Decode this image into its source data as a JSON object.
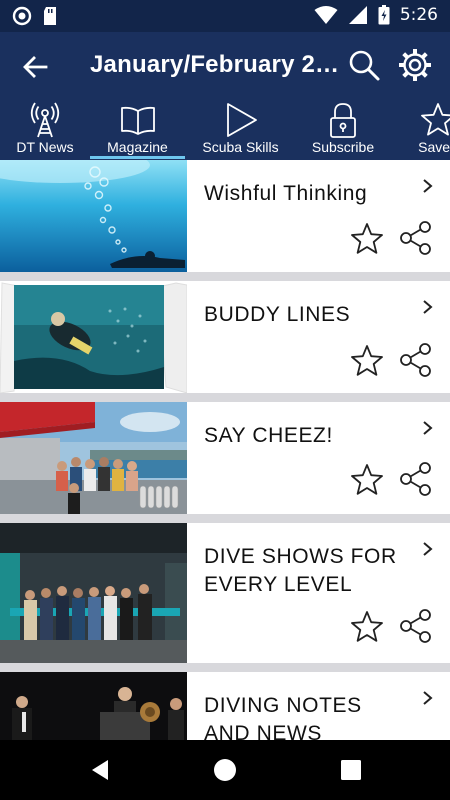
{
  "status_bar": {
    "time": "5:26"
  },
  "app_bar": {
    "title": "January/February 20…"
  },
  "tabs": [
    {
      "label": "DT News",
      "icon": "antenna-icon"
    },
    {
      "label": "Magazine",
      "icon": "book-icon"
    },
    {
      "label": "Scuba Skills",
      "icon": "play-icon"
    },
    {
      "label": "Subscribe",
      "icon": "lock-icon"
    },
    {
      "label": "Saved",
      "icon": "star-icon"
    }
  ],
  "active_tab": "Magazine",
  "articles": [
    {
      "title": "Wishful Thinking"
    },
    {
      "title": "BUDDY LINES"
    },
    {
      "title": "SAY CHEEZ!"
    },
    {
      "title": "DIVE SHOWS FOR EVERY LEVEL"
    },
    {
      "title": "DIVING NOTES AND NEWS"
    }
  ],
  "colors": {
    "header": "#1a305e",
    "status_bar": "#12254a",
    "tab_indicator": "#6ec6ee",
    "divider": "#d8d8dc"
  }
}
